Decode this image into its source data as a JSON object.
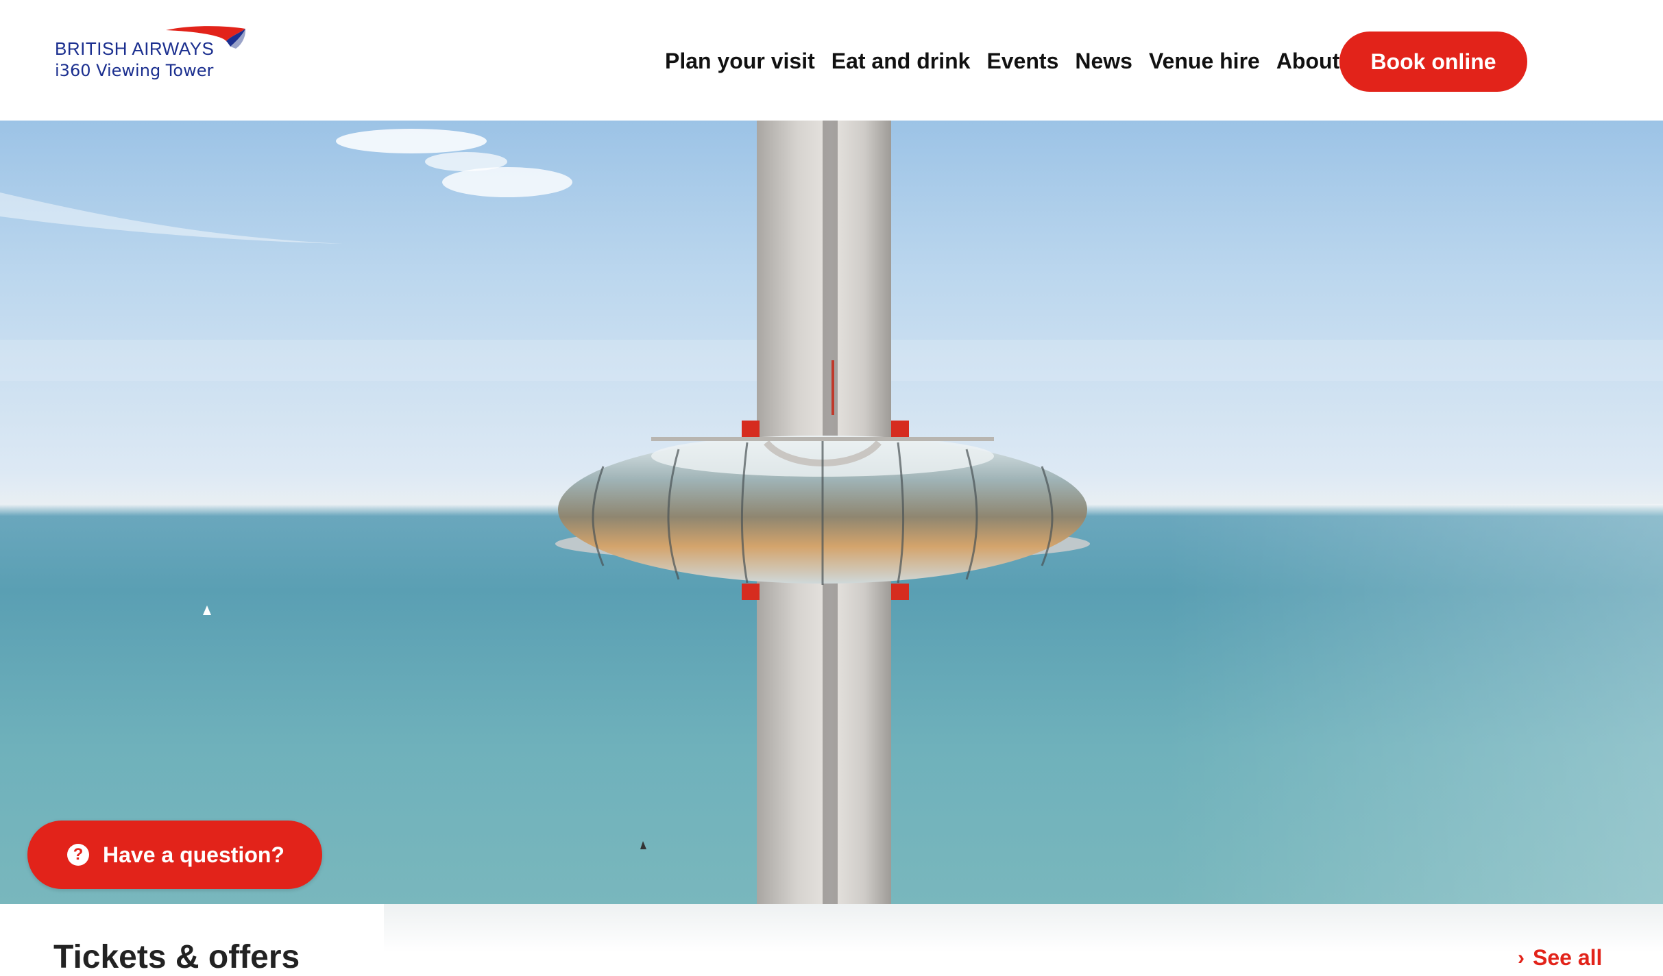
{
  "logo": {
    "brand": "BRITISH AIRWAYS",
    "sub": "i360 Viewing Tower",
    "brand_color": "#1b2f8f",
    "swoosh_icon": "ba-speedmarque-icon"
  },
  "nav": {
    "items": [
      {
        "label": "Plan your visit"
      },
      {
        "label": "Eat and drink"
      },
      {
        "label": "Events"
      },
      {
        "label": "News"
      },
      {
        "label": "Venue hire"
      },
      {
        "label": "About"
      }
    ],
    "book_label": "Book online"
  },
  "hero": {
    "image": "tower-observation-pod-over-sea",
    "question_label": "Have a question?",
    "question_icon": "question-circle-icon"
  },
  "tickets": {
    "title": "Tickets & offers",
    "see_all_label": "See all",
    "see_all_icon": "chevron-right-icon"
  },
  "colors": {
    "accent": "#e2231a",
    "text": "#111111"
  }
}
